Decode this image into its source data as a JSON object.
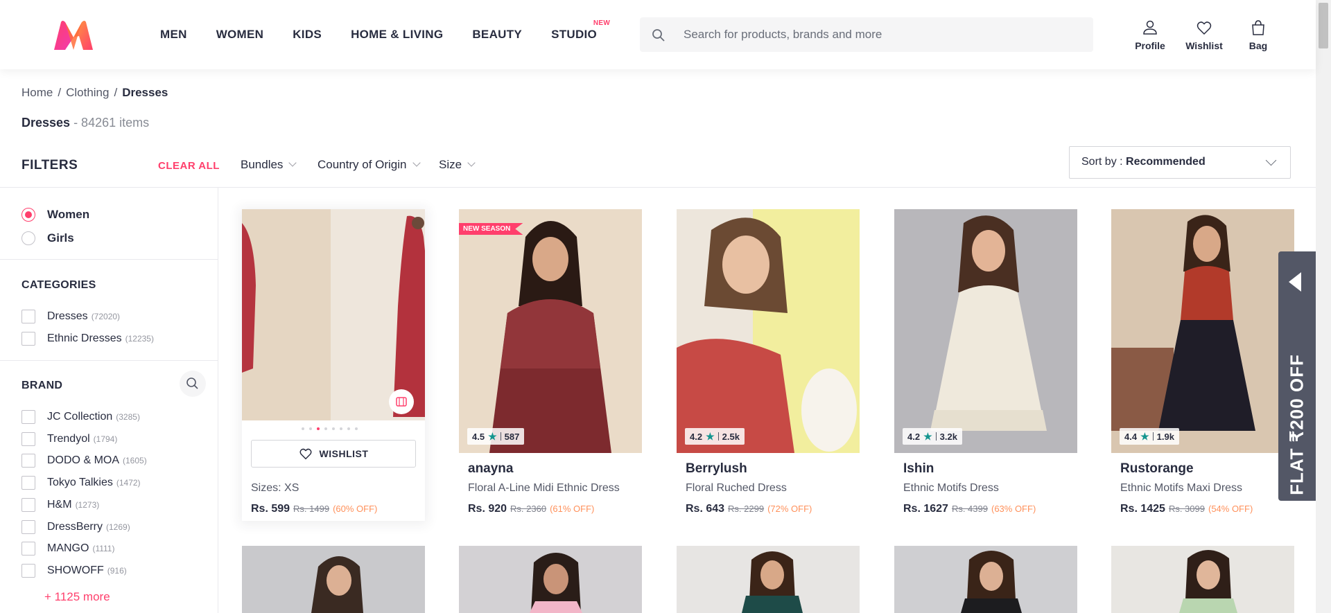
{
  "header": {
    "logo": "Myntra",
    "nav": [
      "MEN",
      "WOMEN",
      "KIDS",
      "HOME & LIVING",
      "BEAUTY",
      "STUDIO"
    ],
    "studio_badge": "NEW",
    "search_placeholder": "Search for products, brands and more",
    "actions": {
      "profile": "Profile",
      "wishlist": "Wishlist",
      "bag": "Bag"
    }
  },
  "breadcrumb": {
    "home": "Home",
    "clothing": "Clothing",
    "current": "Dresses",
    "sep": "/"
  },
  "title": {
    "name": "Dresses",
    "count": " - 84261 items"
  },
  "filters": {
    "heading": "FILTERS",
    "clear_all": "CLEAR ALL",
    "top_filters": [
      "Bundles",
      "Country of Origin",
      "Size"
    ],
    "sort_label": "Sort by : ",
    "sort_value": "Recommended",
    "gender": [
      {
        "label": "Women",
        "selected": true
      },
      {
        "label": "Girls",
        "selected": false
      }
    ],
    "categories_title": "CATEGORIES",
    "categories": [
      {
        "label": "Dresses",
        "count": "(72020)"
      },
      {
        "label": "Ethnic Dresses",
        "count": "(12235)"
      }
    ],
    "brand_title": "BRAND",
    "brands": [
      {
        "label": "JC Collection",
        "count": "(3285)"
      },
      {
        "label": "Trendyol",
        "count": "(1794)"
      },
      {
        "label": "DODO & MOA",
        "count": "(1605)"
      },
      {
        "label": "Tokyo Talkies",
        "count": "(1472)"
      },
      {
        "label": "H&M",
        "count": "(1273)"
      },
      {
        "label": "DressBerry",
        "count": "(1269)"
      },
      {
        "label": "MANGO",
        "count": "(1111)"
      },
      {
        "label": "SHOWOFF",
        "count": "(916)"
      }
    ],
    "more": "+ 1125 more"
  },
  "hover_card": {
    "wishlist": "WISHLIST",
    "sizes": "Sizes: XS",
    "price": "Rs. 599",
    "mrp": "Rs. 1499",
    "off": "(60% OFF)"
  },
  "products": [
    {
      "badge": "NEW SEASON",
      "rating": "4.5",
      "reviews": "587",
      "brand": "anayna",
      "name": "Floral A-Line Midi Ethnic Dress",
      "price": "Rs. 920",
      "mrp": "Rs. 2360",
      "off": "(61% OFF)"
    },
    {
      "badge": "",
      "rating": "4.2",
      "reviews": "2.5k",
      "brand": "Berrylush",
      "name": "Floral Ruched Dress",
      "price": "Rs. 643",
      "mrp": "Rs. 2299",
      "off": "(72% OFF)"
    },
    {
      "badge": "",
      "rating": "4.2",
      "reviews": "3.2k",
      "brand": "Ishin",
      "name": "Ethnic Motifs Dress",
      "price": "Rs. 1627",
      "mrp": "Rs. 4399",
      "off": "(63% OFF)"
    },
    {
      "badge": "",
      "rating": "4.4",
      "reviews": "1.9k",
      "brand": "Rustorange",
      "name": "Ethnic Motifs Maxi Dress",
      "price": "Rs. 1425",
      "mrp": "Rs. 3099",
      "off": "(54% OFF)"
    }
  ],
  "offer_tab": "FLAT ₹200 OFF",
  "colors": {
    "accent": "#ff3f6c",
    "rating_star": "#14958f",
    "discount": "#ff905a"
  }
}
